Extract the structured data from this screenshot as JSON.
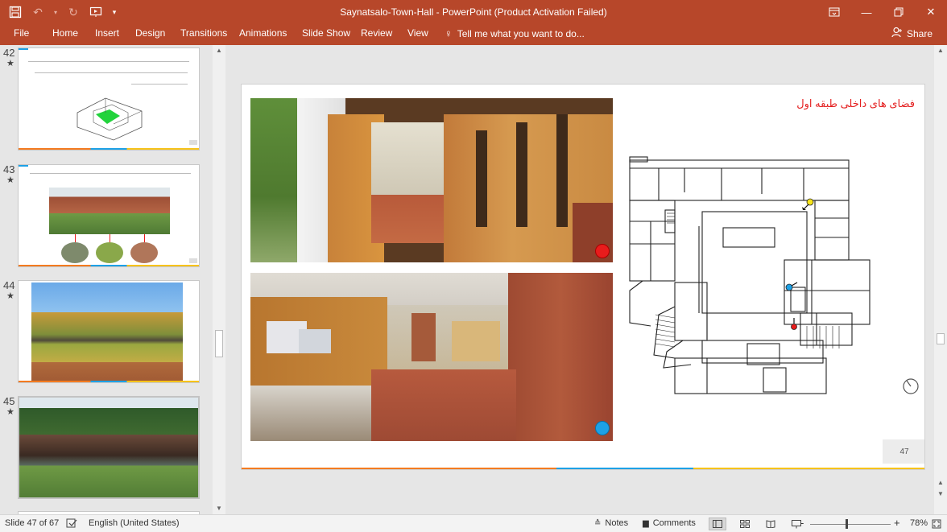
{
  "window": {
    "title": "Saynatsalo-Town-Hall - PowerPoint (Product Activation Failed)"
  },
  "ribbon": {
    "tabs": [
      "File",
      "Home",
      "Insert",
      "Design",
      "Transitions",
      "Animations",
      "Slide Show",
      "Review",
      "View"
    ],
    "tell_me": "Tell me what you want to do...",
    "share": "Share"
  },
  "thumbnails": [
    {
      "number": "42",
      "star": "★"
    },
    {
      "number": "43",
      "star": "★"
    },
    {
      "number": "44",
      "star": "★"
    },
    {
      "number": "45",
      "star": "★"
    }
  ],
  "slide": {
    "title": "فضای های داخلی طبقه اول",
    "number": "47"
  },
  "status": {
    "slide_info": "Slide 47 of 67",
    "language": "English (United States)",
    "notes": "Notes",
    "comments": "Comments",
    "zoom_minus": "-",
    "zoom_plus": "+",
    "zoom": "78%"
  },
  "colors": {
    "accent": "#b7472a",
    "marker_red": "#e81c1c",
    "marker_blue": "#1da1e6",
    "marker_yellow": "#f7e51a",
    "title_red": "#e41f1f"
  }
}
